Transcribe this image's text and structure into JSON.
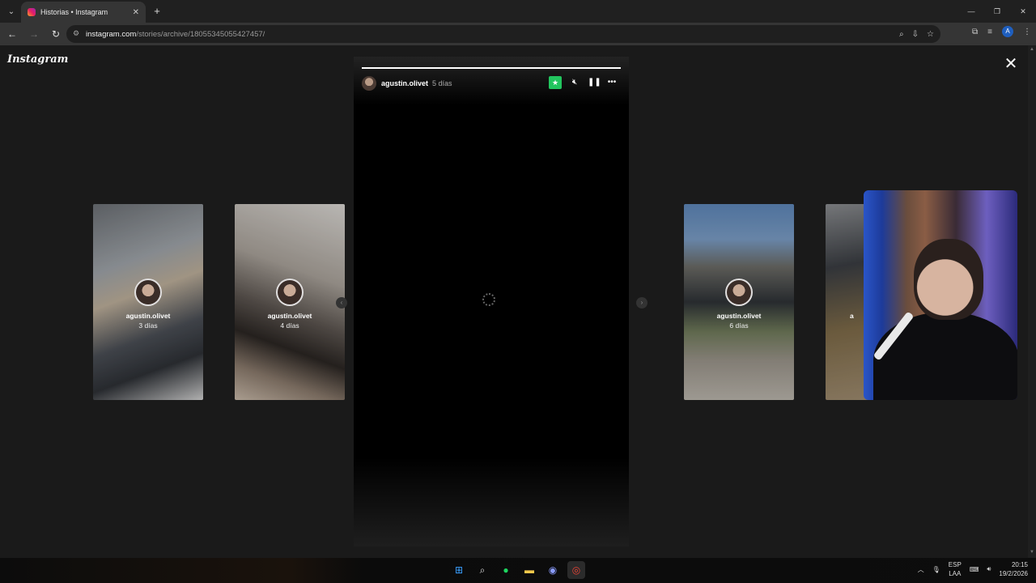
{
  "browser": {
    "tab_title": "Historias • Instagram",
    "tab_close": "✕",
    "new_tab": "+",
    "url_host": "instagram.com",
    "url_path": "/stories/archive/18055345055427457/",
    "profile_initial": "A"
  },
  "page": {
    "logo": "Instagram",
    "close": "✕"
  },
  "story": {
    "username": "agustin.olivet",
    "time": "5 días",
    "progress": 1.0
  },
  "side_stories": [
    {
      "username": "agustin.olivet",
      "time": "3 días"
    },
    {
      "username": "agustin.olivet",
      "time": "4 días"
    },
    {
      "username": "agustin.olivet",
      "time": "6 días"
    },
    {
      "username": "a",
      "time": ""
    }
  ],
  "taskbar": {
    "lang_top": "ESP",
    "lang_bottom": "LAA",
    "time": "20:15",
    "date": "19/2/2026"
  },
  "colors": {
    "accent_star": "#22c55e",
    "profile": "#1f5fbf"
  }
}
